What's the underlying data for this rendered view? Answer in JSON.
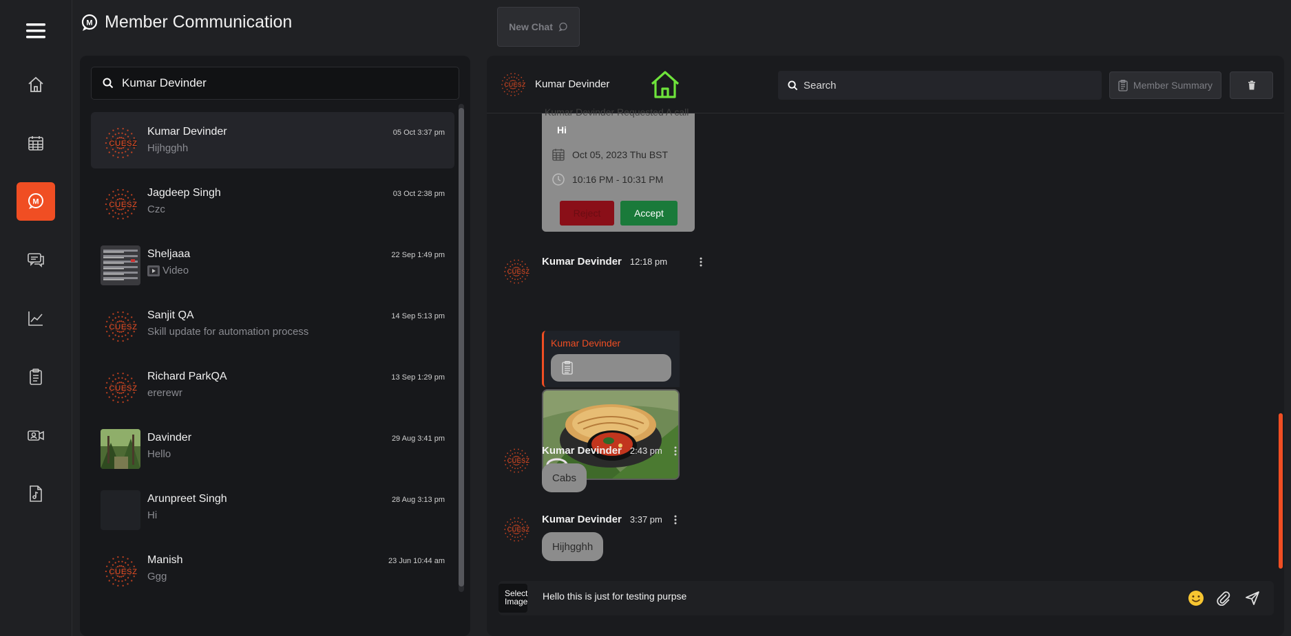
{
  "app": {
    "title": "Member Communication"
  },
  "new_chat": {
    "label": "New Chat"
  },
  "nav": [
    "home",
    "calendar",
    "member-communication",
    "chat",
    "analytics",
    "clipboard",
    "video",
    "audio-file"
  ],
  "contact_search": {
    "value": "Kumar Devinder"
  },
  "contacts": [
    {
      "name": "Kumar Devinder",
      "preview": "Hijhgghh",
      "time": "05 Oct 3:37 pm",
      "avatar": "cuesz-logo",
      "selected": true
    },
    {
      "name": "Jagdeep Singh",
      "preview": "Czc",
      "time": "03 Oct 2:38 pm",
      "avatar": "cuesz-logo"
    },
    {
      "name": "Sheljaaa",
      "preview": "Video",
      "time": "22 Sep 1:49 pm",
      "avatar": "screenshot-thumb"
    },
    {
      "name": "Sanjit QA",
      "preview": "Skill update for automation process",
      "time": "14 Sep 5:13 pm",
      "avatar": "cuesz-logo"
    },
    {
      "name": "Richard ParkQA",
      "preview": "ererewr",
      "time": "13 Sep 1:29 pm",
      "avatar": "cuesz-logo"
    },
    {
      "name": "Davinder",
      "preview": "Hello",
      "time": "29 Aug 3:41 pm",
      "avatar": "forest-photo"
    },
    {
      "name": "Arunpreet Singh",
      "preview": "Hi",
      "time": "28 Aug 3:13 pm",
      "avatar": "blank"
    },
    {
      "name": "Manish",
      "preview": "Ggg",
      "time": "23 Jun 10:44 am",
      "avatar": "cuesz-logo"
    }
  ],
  "chat": {
    "header_name": "Kumar Devinder",
    "search_placeholder": "Search",
    "member_summary_label": "Member Summary",
    "meeting_card": {
      "cut_text": "Kumar Devinder Requested A call",
      "greeting": "Hi",
      "date": "Oct 05, 2023 Thu BST",
      "time_range": "10:16 PM - 10:31 PM",
      "reject_label": "Reject",
      "accept_label": "Accept"
    },
    "messages": [
      {
        "author": "Kumar Devinder",
        "time": "12:18 pm",
        "reply_to": "Kumar Devinder",
        "attachment": "document-icon",
        "image": "food-photo"
      },
      {
        "author": "Kumar Devinder",
        "time": "2:43 pm",
        "text": "Cabs"
      },
      {
        "author": "Kumar Devinder",
        "time": "3:37 pm",
        "text": "Hijhgghh"
      }
    ],
    "composer": {
      "select_image_label": "Select Image",
      "value": "Hello this is just for testing purpse"
    }
  },
  "logo_text": "CUESZ",
  "colors": {
    "accent": "#f04e23",
    "accept": "#1a7a3a",
    "reject": "#8a0f18",
    "home_icon": "#6ee33b"
  }
}
